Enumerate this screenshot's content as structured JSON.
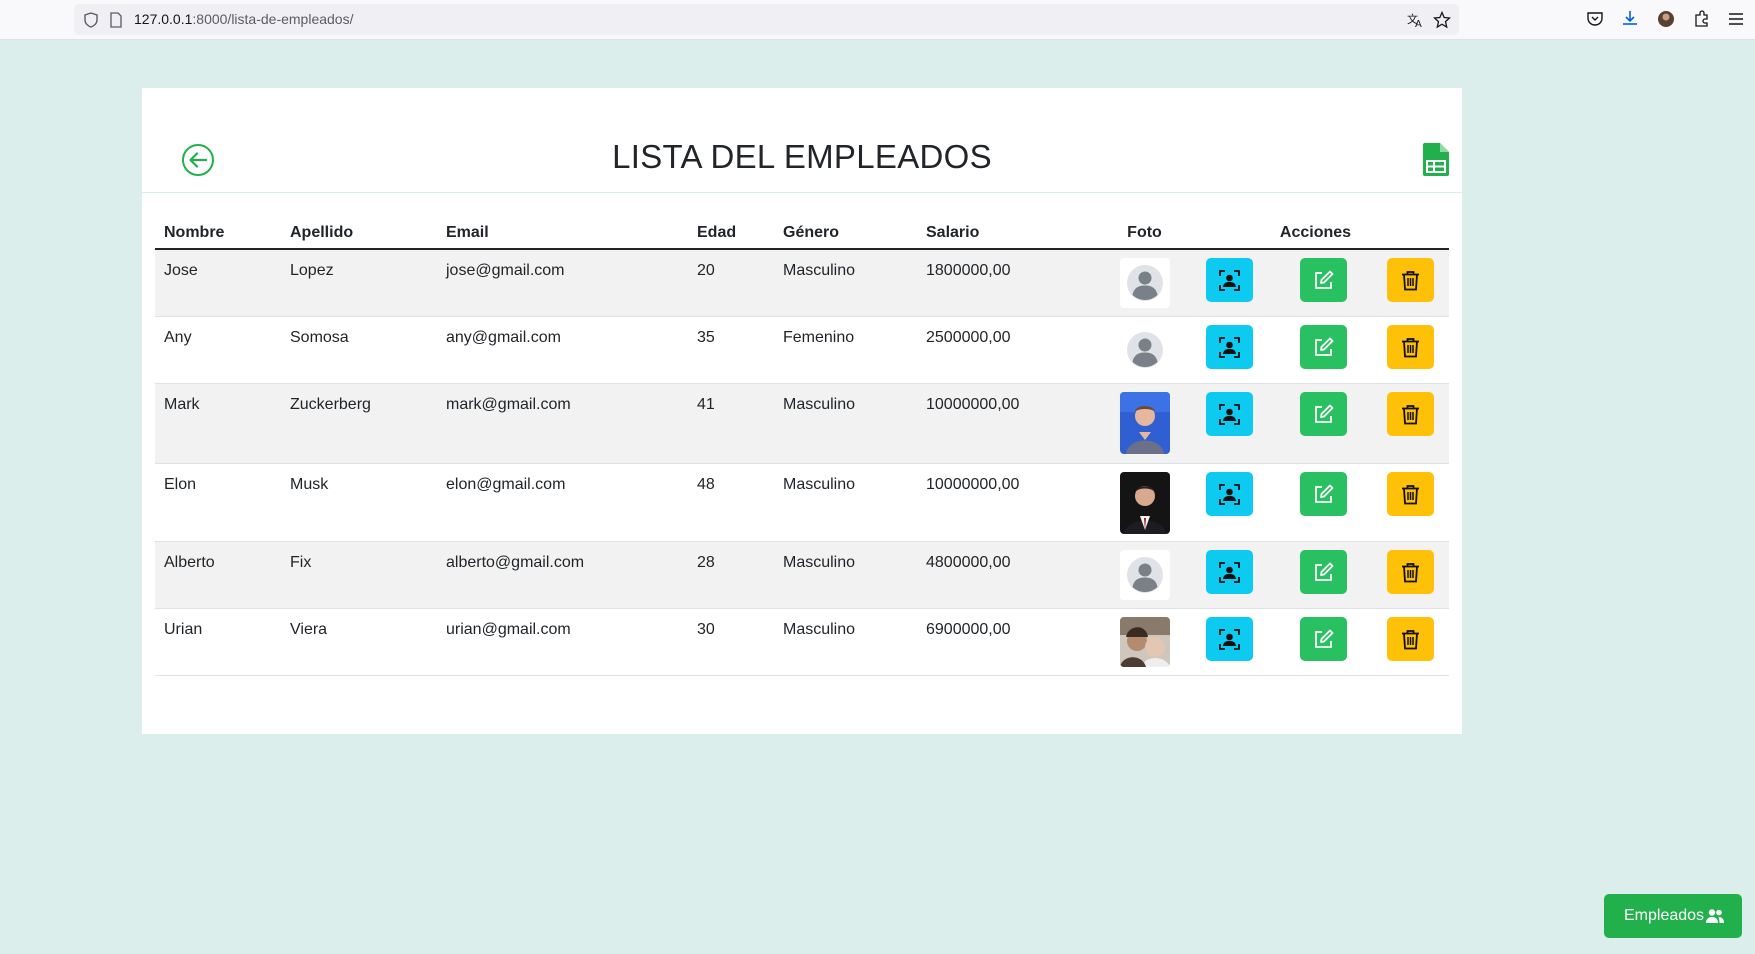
{
  "browser": {
    "url_host": "127.0.0.1",
    "url_rest": ":8000/lista-de-empleados/"
  },
  "page": {
    "title": "LISTA DEL EMPLEADOS",
    "floating_button_label": "Empleados"
  },
  "table": {
    "headers": [
      "Nombre",
      "Apellido",
      "Email",
      "Edad",
      "Género",
      "Salario",
      "Foto",
      "Acciones"
    ],
    "rows": [
      {
        "nombre": "Jose",
        "apellido": "Lopez",
        "email": "jose@gmail.com",
        "edad": "20",
        "genero": "Masculino",
        "salario": "1800000,00",
        "foto": "default-avatar"
      },
      {
        "nombre": "Any",
        "apellido": "Somosa",
        "email": "any@gmail.com",
        "edad": "35",
        "genero": "Femenino",
        "salario": "2500000,00",
        "foto": "default-avatar"
      },
      {
        "nombre": "Mark",
        "apellido": "Zuckerberg",
        "email": "mark@gmail.com",
        "edad": "41",
        "genero": "Masculino",
        "salario": "10000000,00",
        "foto": "portrait-photo"
      },
      {
        "nombre": "Elon",
        "apellido": "Musk",
        "email": "elon@gmail.com",
        "edad": "48",
        "genero": "Masculino",
        "salario": "10000000,00",
        "foto": "portrait-photo"
      },
      {
        "nombre": "Alberto",
        "apellido": "Fix",
        "email": "alberto@gmail.com",
        "edad": "28",
        "genero": "Masculino",
        "salario": "4800000,00",
        "foto": "default-avatar"
      },
      {
        "nombre": "Urian",
        "apellido": "Viera",
        "email": "urian@gmail.com",
        "edad": "30",
        "genero": "Masculino",
        "salario": "6900000,00",
        "foto": "group-photo"
      }
    ]
  },
  "colors": {
    "page_bg": "#dceeec",
    "primary_green": "#21b04b",
    "info_cyan": "#0dcaf0",
    "edit_green": "#28c060",
    "delete_yellow": "#ffc107"
  }
}
